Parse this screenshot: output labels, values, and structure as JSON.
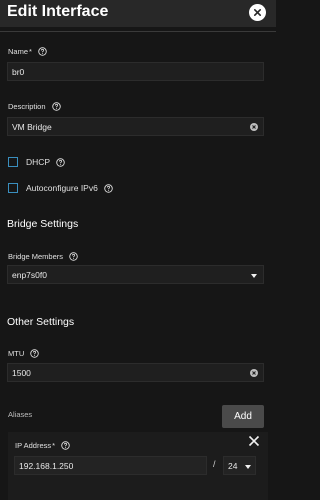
{
  "dialog": {
    "title": "Edit Interface"
  },
  "form": {
    "name": {
      "label": "Name",
      "required_mark": "*",
      "value": "br0"
    },
    "description": {
      "label": "Description",
      "value": "VM Bridge"
    },
    "dhcp": {
      "label": "DHCP",
      "checked": false
    },
    "autoconfig_ipv6": {
      "label": "Autoconfigure IPv6",
      "checked": false
    }
  },
  "bridge_settings": {
    "heading": "Bridge Settings",
    "members_label": "Bridge Members",
    "members_value": "enp7s0f0"
  },
  "other_settings": {
    "heading": "Other Settings",
    "mtu_label": "MTU",
    "mtu_value": "1500"
  },
  "aliases": {
    "label": "Aliases",
    "add_label": "Add",
    "ip_label": "IP Address",
    "required_mark": "*",
    "ip_value": "192.168.1.250",
    "separator": "/",
    "netmask": "24"
  },
  "icons": {
    "close": "close-icon",
    "help": "help-circle-icon",
    "clear": "clear-icon",
    "dropdown": "chevron-down-icon"
  },
  "colors": {
    "background": "#161616",
    "header": "#282828",
    "checkbox_border": "#3a8fbf",
    "add_button": "#4a4a4a"
  }
}
